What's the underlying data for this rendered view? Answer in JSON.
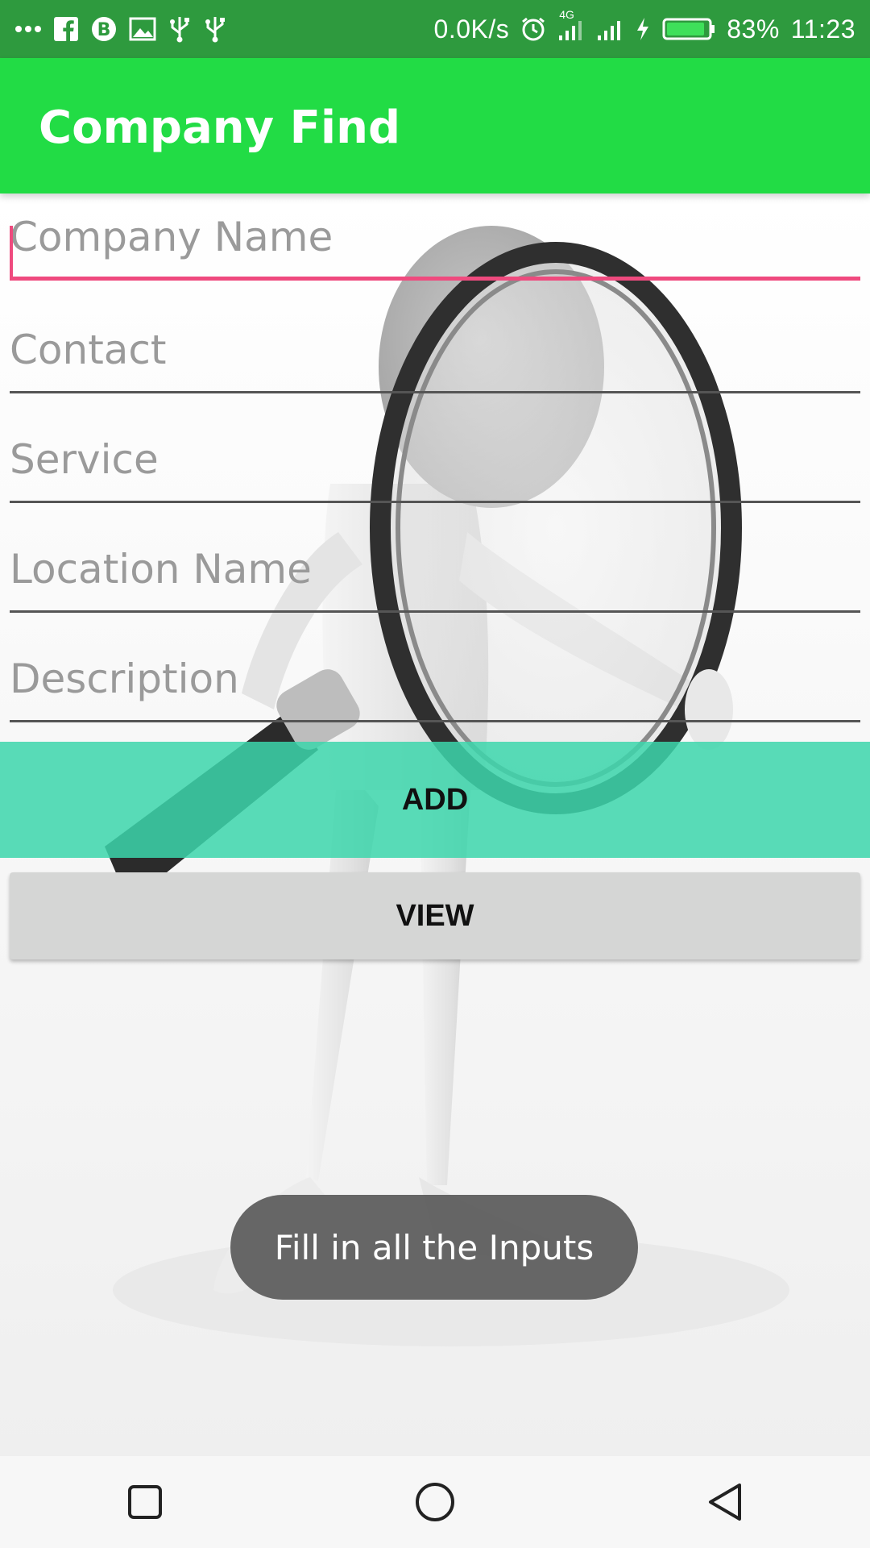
{
  "status_bar": {
    "network_speed": "0.0K/s",
    "network_type": "4G",
    "battery": "83%",
    "time": "11:23",
    "left_icons": [
      "more-dots-icon",
      "facebook-icon",
      "bitcoin-icon",
      "gallery-icon",
      "usb-icon",
      "usb-icon"
    ],
    "right_icons": [
      "alarm-icon",
      "signal-4g-icon",
      "signal-icon",
      "charging-icon",
      "battery-icon"
    ]
  },
  "app_bar": {
    "title": "Company Find"
  },
  "form": {
    "fields": [
      {
        "name": "company-name",
        "placeholder": "Company Name",
        "value": "",
        "focused": true
      },
      {
        "name": "contact",
        "placeholder": "Contact",
        "value": "",
        "focused": false
      },
      {
        "name": "service",
        "placeholder": "Service",
        "value": "",
        "focused": false
      },
      {
        "name": "location-name",
        "placeholder": "Location Name",
        "value": "",
        "focused": false
      },
      {
        "name": "description",
        "placeholder": "Description",
        "value": "",
        "focused": false
      }
    ]
  },
  "buttons": {
    "add_label": "ADD",
    "view_label": "VIEW"
  },
  "toast": {
    "message": "Fill in all the Inputs"
  },
  "nav_bar": {
    "items": [
      "recents-square-icon",
      "home-circle-icon",
      "back-triangle-icon"
    ]
  },
  "colors": {
    "status_bar": "#2e9a3e",
    "app_bar": "#22dc45",
    "accent": "#ef4a7e",
    "add_button": "#3cd6ab",
    "view_button": "#d5d6d5"
  }
}
